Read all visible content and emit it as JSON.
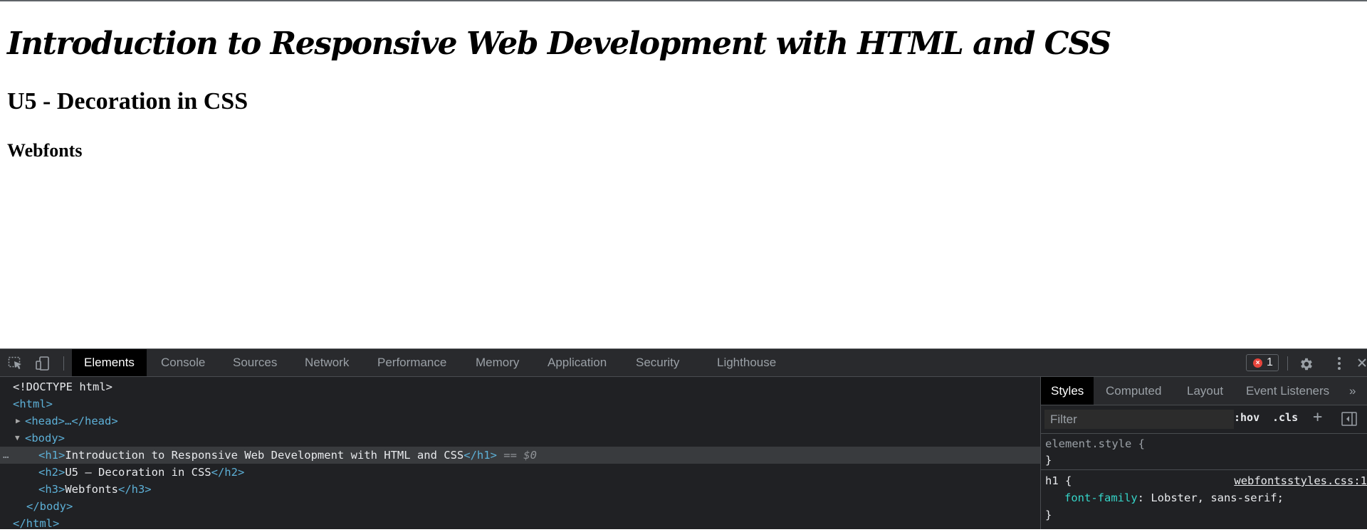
{
  "page": {
    "h1": "Introduction to Responsive Web Development with HTML and CSS",
    "h2": "U5 - Decoration in CSS",
    "h3": "Webfonts"
  },
  "devtools": {
    "tabs": [
      "Elements",
      "Console",
      "Sources",
      "Network",
      "Performance",
      "Memory",
      "Application",
      "Security",
      "Lighthouse"
    ],
    "active_tab": "Elements",
    "error_count": "1",
    "error_mark": "×",
    "dom": {
      "doctype": "<!DOCTYPE html>",
      "html_open": "<html>",
      "head_collapsed": "<head>…</head>",
      "body_open": "<body>",
      "h1_open": "<h1>",
      "h1_text": "Introduction to Responsive Web Development with HTML and CSS",
      "h1_close": "</h1>",
      "selected_marker": "== $0",
      "h2_open": "<h2>",
      "h2_text": "U5 – Decoration in CSS",
      "h2_close": "</h2>",
      "h3_open": "<h3>",
      "h3_text": "Webfonts",
      "h3_close": "</h3>",
      "body_close": "</body>",
      "html_close": "</html>",
      "ellipsis": "…"
    },
    "sidebar": {
      "tabs": [
        "Styles",
        "Computed",
        "Layout",
        "Event Listeners"
      ],
      "active_tab": "Styles",
      "more": "»",
      "filter_placeholder": "Filter",
      "hov": ":hov",
      "cls": ".cls",
      "plus": "+",
      "rules": [
        {
          "selector": "element.style {",
          "close": "}"
        },
        {
          "selector": "h1 {",
          "source": "webfontsstyles.css:1",
          "property": "font-family",
          "value": "Lobster, sans-serif;",
          "close": "}"
        }
      ]
    }
  }
}
